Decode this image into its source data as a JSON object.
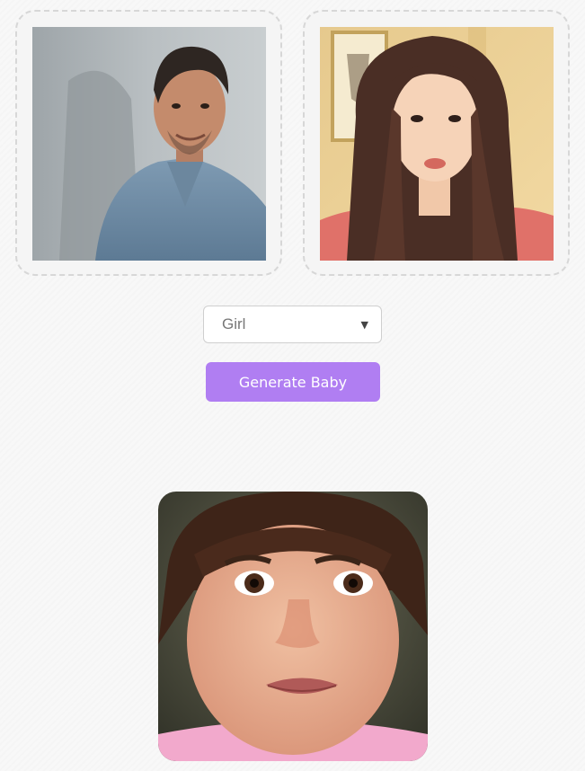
{
  "parents": {
    "father": {
      "alt": "father-photo"
    },
    "mother": {
      "alt": "mother-photo"
    }
  },
  "gender_select": {
    "selected": "Girl",
    "caret": "▼"
  },
  "generate_button": {
    "label": "Generate Baby"
  },
  "colors": {
    "accent": "#b07ef2",
    "card_border": "#d7d7d7",
    "background": "#f8f8f8"
  }
}
